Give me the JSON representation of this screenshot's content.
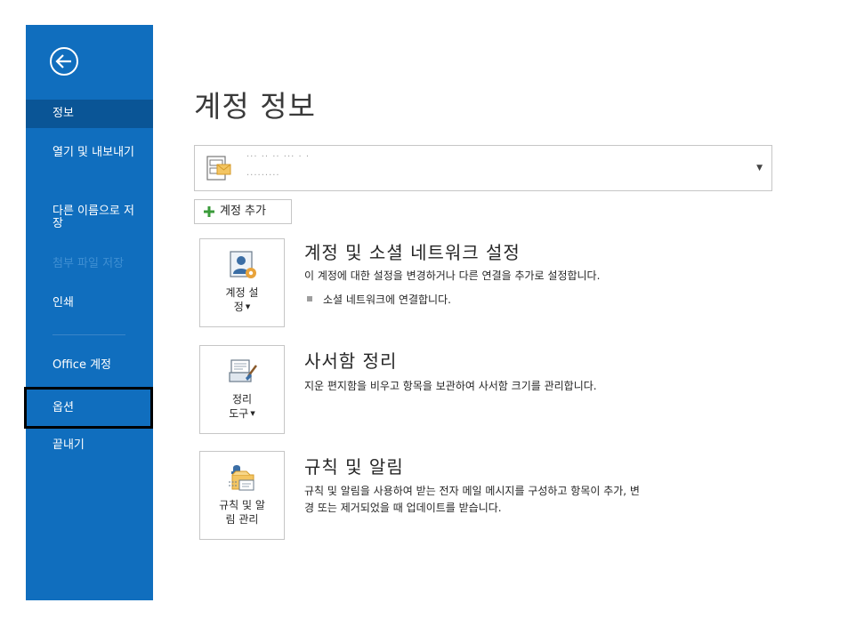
{
  "sidebar": {
    "back_label": "",
    "items": [
      {
        "label": "정보"
      },
      {
        "label": "열기 및 내보내기"
      },
      {
        "label": "다른 이름으로 저장"
      },
      {
        "label": "첨부 파일 저장"
      },
      {
        "label": "인쇄"
      },
      {
        "label": "Office 계정"
      },
      {
        "label": "옵션"
      },
      {
        "label": "끝내기"
      }
    ]
  },
  "main": {
    "title": "계정 정보",
    "account": {
      "line1": "··· ·· ·· ··· · ·",
      "line2": "·········"
    },
    "add_account_label": "계정 추가",
    "sections": [
      {
        "button_label_line1": "계정 설",
        "button_label_line2": "정",
        "title": "계정 및 소셜 네트워크 설정",
        "desc": "이 계정에 대한 설정을 변경하거나 다른 연결을 추가로 설정합니다.",
        "bullet": "소셜 네트워크에 연결합니다."
      },
      {
        "button_label_line1": "정리",
        "button_label_line2": "도구",
        "title": "사서함 정리",
        "desc": "지운 편지함을 비우고 항목을 보관하여 사서함 크기를 관리합니다."
      },
      {
        "button_label_line1": "규칙 및 알",
        "button_label_line2": "림 관리",
        "title": "규칙 및 알림",
        "desc_line1": "규칙 및 알림을 사용하여 받는 전자 메일 메시지를 구성하고 항목이 추가, 변",
        "desc_line2": "경 또는 제거되었을 때 업데이트를 받습니다."
      }
    ]
  },
  "colors": {
    "sidebar": "#106ebe",
    "sidebar_active": "#0a5596",
    "accent_green": "#3a9b3a",
    "accent_orange": "#e8a33b"
  }
}
